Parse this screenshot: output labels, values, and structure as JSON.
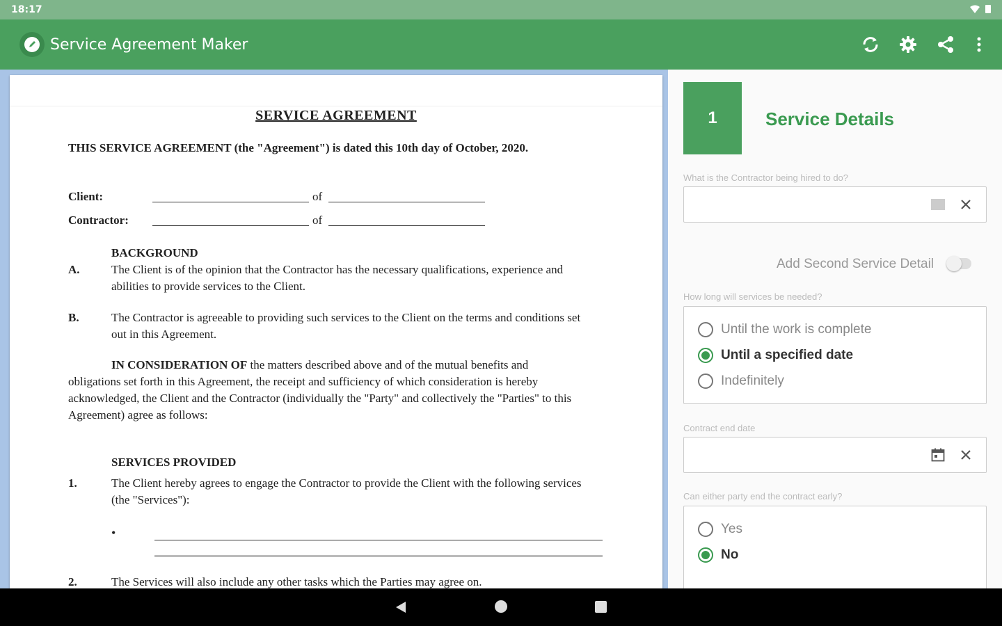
{
  "status": {
    "time": "18:17"
  },
  "app": {
    "title": "Service Agreement Maker"
  },
  "colors": {
    "primary": "#4aa05e",
    "status_bar": "#7fb58b",
    "accent": "#3a9a50"
  },
  "icons": {
    "refresh": "refresh-icon",
    "settings": "gear-icon",
    "share": "share-icon",
    "menu": "more-vert-icon"
  },
  "document": {
    "title": "SERVICE AGREEMENT",
    "intro": "THIS SERVICE AGREEMENT (the \"Agreement\") is dated this 10th day of October, 2020.",
    "client_label": "Client:",
    "contractor_label": "Contractor:",
    "of_word": "of",
    "background_head": "BACKGROUND",
    "item_a_num": "A.",
    "item_a_text": "The Client is of the opinion that the Contractor has the necessary qualifications, experience and abilities to provide services to the Client.",
    "item_b_num": "B.",
    "item_b_text": "The Contractor is agreeable to providing such services to the Client on the terms and conditions set out in this Agreement.",
    "consideration_lead": "IN CONSIDERATION OF",
    "consideration_rest": " the matters described above and of the mutual benefits and obligations set forth in this Agreement, the receipt and sufficiency of which consideration is hereby acknowledged, the Client and the Contractor (individually the \"Party\" and collectively the \"Parties\" to this Agreement) agree as follows:",
    "services_head": "SERVICES PROVIDED",
    "item_1_num": "1.",
    "item_1_text": "The Client hereby agrees to engage the Contractor to provide the Client with the following services (the \"Services\"):",
    "bullet": "•",
    "item_2_num": "2.",
    "item_2_text": "The Services will also include any other tasks which the Parties may agree on."
  },
  "form": {
    "step_number": "1",
    "step_title": "Service Details",
    "q1_label": "What is the Contractor being hired to do?",
    "q1_value": "",
    "toggle_label": "Add Second Service Detail",
    "toggle_on": false,
    "q2_label": "How long will services be needed?",
    "q2_options": [
      "Until the work is complete",
      "Until a specified date",
      "Indefinitely"
    ],
    "q2_selected": "Until a specified date",
    "q3_label": "Contract end date",
    "q3_value": "",
    "q4_label": "Can either party end the contract early?",
    "q4_options": [
      "Yes",
      "No"
    ],
    "q4_selected": "No"
  }
}
